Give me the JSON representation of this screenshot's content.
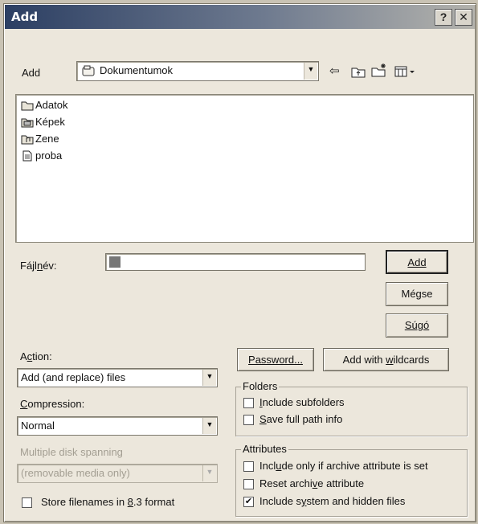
{
  "window": {
    "title": "Add",
    "help_btn": "?",
    "close_btn": "✕"
  },
  "lookin": {
    "label": "Add",
    "folder": "Dokumentumok"
  },
  "files": [
    {
      "name": "Adatok",
      "icon": "folder-icon"
    },
    {
      "name": "Képek",
      "icon": "folder-icon"
    },
    {
      "name": "Zene",
      "icon": "folder-icon"
    },
    {
      "name": "proba",
      "icon": "file-icon"
    }
  ],
  "filename": {
    "label_pre": "Fájl",
    "label_ul": "n",
    "label_post": "év:",
    "value": ""
  },
  "buttons": {
    "add": "Add",
    "cancel": "Mégse",
    "help": "Súgó",
    "password": "Password...",
    "wildcards_pre": "Add with ",
    "wildcards_ul": "w",
    "wildcards_post": "ildcards"
  },
  "action": {
    "label_pre": "A",
    "label_ul": "c",
    "label_post": "tion:",
    "value": "Add (and replace) files"
  },
  "compression": {
    "label_pre": "",
    "label_ul": "C",
    "label_post": "ompression:",
    "value": "Normal"
  },
  "spanning": {
    "label": "Multiple disk spanning",
    "value": "(removable media only)"
  },
  "store83": {
    "label_pre": "Store filenames in ",
    "label_ul": "8",
    "label_post": ".3 format",
    "checked": false
  },
  "folders": {
    "label": "Folders",
    "include_subfolders": {
      "pre": "",
      "ul": "I",
      "post": "nclude subfolders",
      "checked": false
    },
    "save_path": {
      "pre": "",
      "ul": "S",
      "post": "ave full path info",
      "checked": false
    }
  },
  "attributes": {
    "label": "Attributes",
    "archive_only": {
      "pre": "Incl",
      "ul": "u",
      "post": "de only if archive attribute is set",
      "checked": false
    },
    "reset_archive": {
      "pre": "Reset archi",
      "ul": "v",
      "post": "e attribute",
      "checked": false
    },
    "system_hidden": {
      "pre": "Include s",
      "ul": "y",
      "post": "stem and hidden files",
      "checked": true
    }
  },
  "icons": [
    "back-icon",
    "up-folder-icon",
    "new-folder-icon",
    "view-menu-icon",
    "dropdown-arrow-icon",
    "check-icon"
  ]
}
